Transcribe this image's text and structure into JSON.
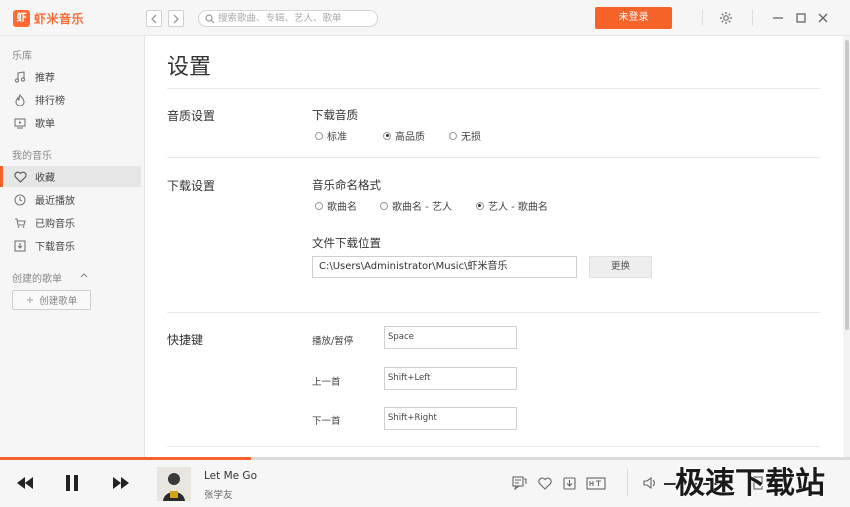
{
  "app": {
    "logo_glyph": "虾",
    "name": "虾米音乐",
    "brand_color": "#f5632b"
  },
  "search": {
    "placeholder": "搜索歌曲、专辑、艺人、歌单"
  },
  "topbar": {
    "login_label": "未登录"
  },
  "sidebar": {
    "library_title": "乐库",
    "library_items": [
      {
        "label": "推荐",
        "icon": "music-note-icon"
      },
      {
        "label": "排行榜",
        "icon": "fire-icon"
      },
      {
        "label": "歌单",
        "icon": "playlist-icon"
      }
    ],
    "my_music_title": "我的音乐",
    "my_music_items": [
      {
        "label": "收藏",
        "icon": "heart-icon",
        "active": true
      },
      {
        "label": "最近播放",
        "icon": "clock-icon"
      },
      {
        "label": "已购音乐",
        "icon": "cart-icon"
      },
      {
        "label": "下载音乐",
        "icon": "download-icon"
      }
    ],
    "created_title": "创建的歌单",
    "create_label": "创建歌单"
  },
  "settings": {
    "title": "设置",
    "quality": {
      "section_label": "音质设置",
      "field_title": "下载音质",
      "options": [
        "标准",
        "高品质",
        "无损"
      ],
      "selected": "高品质"
    },
    "download": {
      "section_label": "下载设置",
      "naming_title": "音乐命名格式",
      "naming_options": [
        "歌曲名",
        "歌曲名 - 艺人",
        "艺人 - 歌曲名"
      ],
      "naming_selected": "艺人 - 歌曲名",
      "location_title": "文件下载位置",
      "path": "C:\\Users\\Administrator\\Music\\虾米音乐",
      "change_label": "更换"
    },
    "hotkeys": {
      "section_label": "快捷键",
      "items": [
        {
          "label": "播放/暂停",
          "value": "Space"
        },
        {
          "label": "上一首",
          "value": "Shift+Left"
        },
        {
          "label": "下一首",
          "value": "Shift+Right"
        }
      ]
    }
  },
  "player": {
    "track_title": "Let Me Go",
    "artist": "张学友",
    "progress": 0.295
  },
  "watermark": "极速下载站"
}
